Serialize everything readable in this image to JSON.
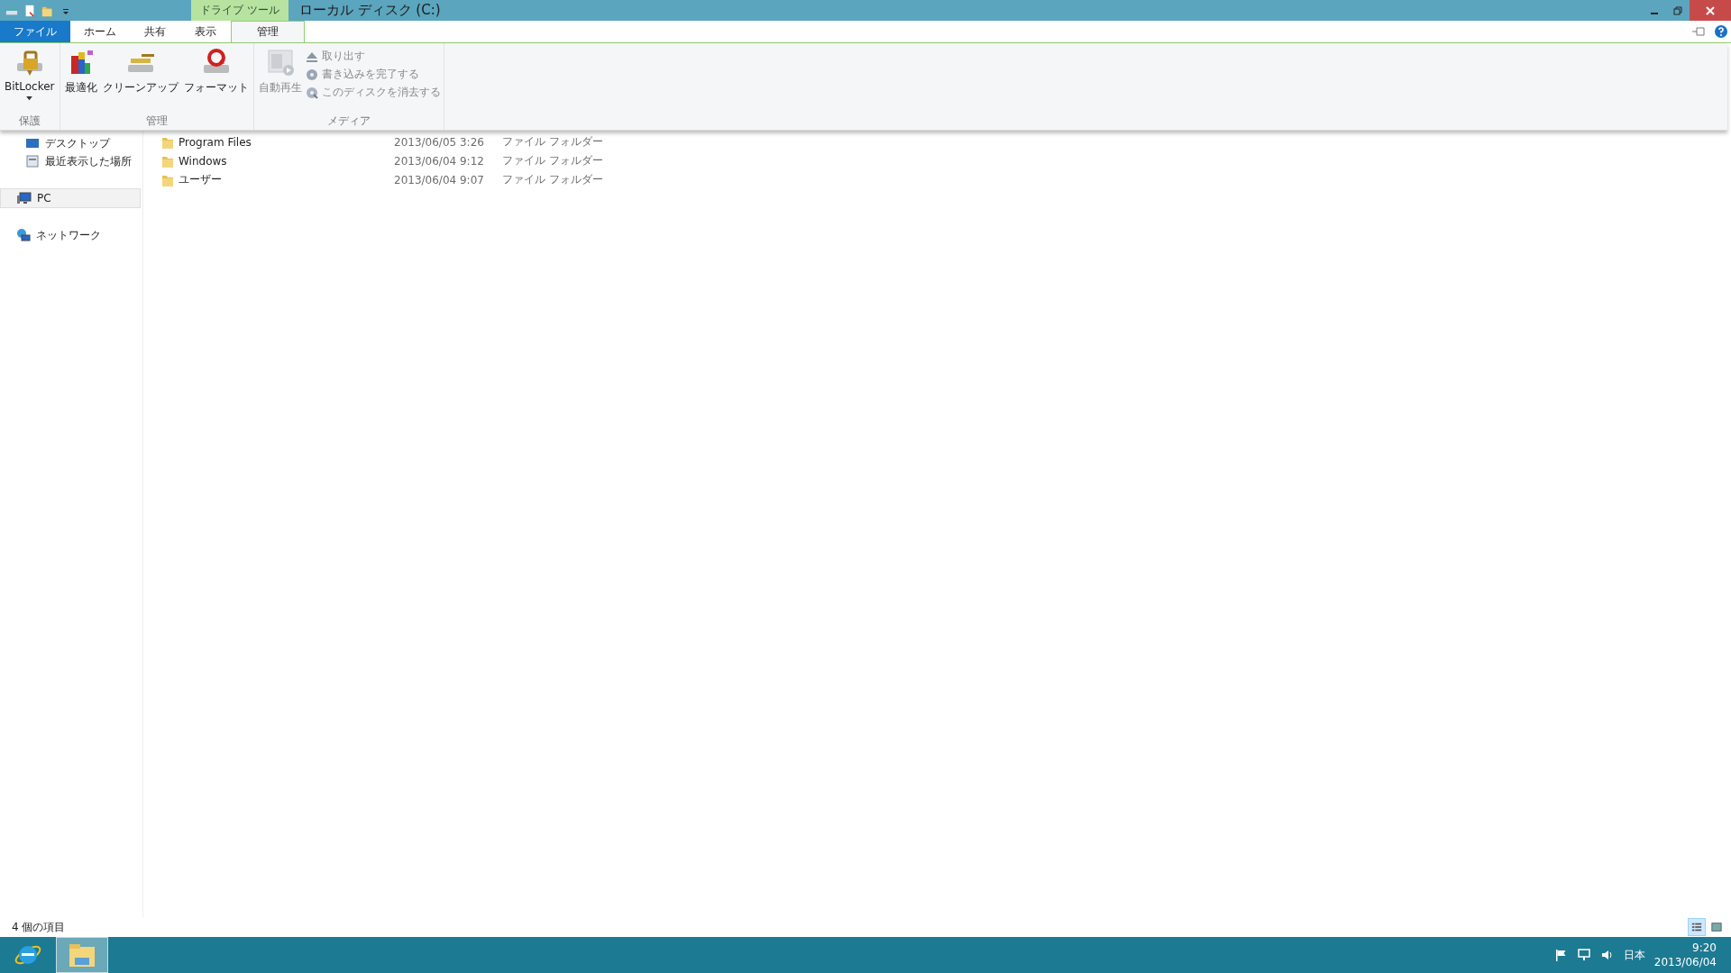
{
  "window": {
    "context_tab": "ドライブ ツール",
    "title": "ローカル ディスク (C:)"
  },
  "ribbon_tabs": [
    {
      "label": "ファイル",
      "kind": "file",
      "selected": false
    },
    {
      "label": "ホーム",
      "kind": "normal",
      "selected": false
    },
    {
      "label": "共有",
      "kind": "normal",
      "selected": false
    },
    {
      "label": "表示",
      "kind": "normal",
      "selected": false
    },
    {
      "label": "管理",
      "kind": "contextual",
      "selected": true
    }
  ],
  "ribbon_groups": [
    {
      "label": "保護",
      "buttons": [
        {
          "label": "BitLocker",
          "kind": "bitlocker",
          "dropdown": true,
          "disabled": false
        }
      ]
    },
    {
      "label": "管理",
      "buttons": [
        {
          "label": "最適化",
          "kind": "optimize",
          "dropdown": false,
          "disabled": false
        },
        {
          "label": "クリーンアップ",
          "kind": "cleanup",
          "dropdown": false,
          "disabled": false
        },
        {
          "label": "フォーマット",
          "kind": "format",
          "dropdown": false,
          "disabled": false
        }
      ]
    },
    {
      "label": "メディア",
      "buttons": [
        {
          "label": "自動再生",
          "kind": "autoplay",
          "dropdown": false,
          "disabled": true
        }
      ],
      "small_buttons": [
        {
          "label": "取り出す",
          "kind": "eject",
          "disabled": true
        },
        {
          "label": "書き込みを完了する",
          "kind": "burn",
          "disabled": true
        },
        {
          "label": "このディスクを消去する",
          "kind": "erase",
          "disabled": true
        }
      ]
    }
  ],
  "nav": [
    {
      "items": [
        {
          "label": "デスクトップ",
          "kind": "desktop",
          "selected": false
        },
        {
          "label": "最近表示した場所",
          "kind": "recent",
          "selected": false
        }
      ]
    },
    {
      "items": [
        {
          "label": "PC",
          "kind": "pc",
          "selected": true
        }
      ]
    },
    {
      "items": [
        {
          "label": "ネットワーク",
          "kind": "network",
          "selected": false
        }
      ]
    }
  ],
  "files": [
    {
      "name": "Program Files",
      "modified": "2013/06/05 3:26",
      "type": "ファイル フォルダー"
    },
    {
      "name": "Windows",
      "modified": "2013/06/04 9:12",
      "type": "ファイル フォルダー"
    },
    {
      "name": "ユーザー",
      "modified": "2013/06/04 9:07",
      "type": "ファイル フォルダー"
    }
  ],
  "status_bar": {
    "item_count": "4 個の項目",
    "views": [
      {
        "kind": "details",
        "selected": true
      },
      {
        "kind": "tiles",
        "selected": false
      }
    ]
  },
  "taskbar": {
    "apps": [
      {
        "kind": "browser",
        "selected": false
      },
      {
        "kind": "explorer",
        "selected": true
      }
    ],
    "language": "日本",
    "time": "9:20",
    "date": "2013/06/04"
  }
}
